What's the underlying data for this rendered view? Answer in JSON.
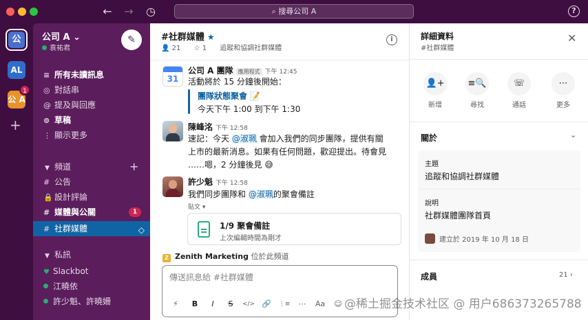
{
  "titlebar": {
    "search_placeholder": "搜尋公司 A",
    "back": "←",
    "forward": "→",
    "history": "◷",
    "help": "?"
  },
  "rail": {
    "active_workspace": "公",
    "workspace_al": "AL",
    "workspace_a": "公 A",
    "workspace_a_badge": "1",
    "add": "+"
  },
  "sidebar": {
    "workspace_name": "公司 A ⌄",
    "user": "袁祐君",
    "nav": [
      {
        "icon": "≡",
        "label": "所有未讀訊息"
      },
      {
        "icon": "◎",
        "label": "對話串"
      },
      {
        "icon": "@",
        "label": "提及與回應"
      },
      {
        "icon": "⊚",
        "label": "草稿"
      },
      {
        "icon": "⋮",
        "label": "顯示更多"
      }
    ],
    "channels_header": "頻道",
    "channels": [
      {
        "label": "公告",
        "icon": "#"
      },
      {
        "label": "設計評論",
        "icon": "🔒"
      },
      {
        "label": "媒體與公關",
        "icon": "#",
        "badge": "1"
      },
      {
        "label": "社群媒體",
        "icon": "#",
        "active_icon": "◇"
      }
    ],
    "dm_header": "私訊",
    "dms": [
      {
        "label": "Slackbot",
        "icon": "heart"
      },
      {
        "label": "江曉依",
        "icon": "dot"
      },
      {
        "label": "許少魁、許曉姍",
        "icon": "dot"
      }
    ]
  },
  "channel": {
    "title": "#社群媒體",
    "star": "★",
    "members": "21",
    "pins": "1",
    "topic": "追蹤和協調社群媒體",
    "info": "i"
  },
  "messages": [
    {
      "author": "公司 A 團隊",
      "badge": "應用程式",
      "time": "下午 12:45",
      "calendar_day": "31",
      "lines": [
        "活動將於 15 分鐘後開始："
      ],
      "event_title": "團隊狀態聚會",
      "event_emoji": "📝",
      "event_time": "今天下午 1:00 到下午 1:30"
    },
    {
      "author": "陳峰洺",
      "time": "下午 12:58",
      "line1_pre": "速記：今天 ",
      "line1_mention": "@淑珮",
      "line1_post": " 會加入我們的同步團隊，提供有關",
      "line2": "上市的最新消息。如果有任何問題，歡迎提出。待會見",
      "line3": "……嗯，2 分鐘後見 😅"
    },
    {
      "author": "許少魁",
      "time": "下午 12:58",
      "line1_pre": "我們同步團隊和 ",
      "line1_mention": "@淑珮",
      "line1_post": "的聚會備註",
      "attachment_label": "貼文 ▾",
      "file_title": "1/9 聚會備註",
      "file_sub": "上次編輯時間為剛才"
    }
  ],
  "typing": {
    "icon": "Z",
    "name": "Zenith Marketing",
    "suffix": " 位於此頻道"
  },
  "composer": {
    "placeholder": "傳送訊息給 #社群媒體",
    "tools": [
      "⚡",
      "B",
      "I",
      "S",
      "</>",
      "🔗",
      "⋮≡",
      "⋯",
      "Aa",
      "☺"
    ]
  },
  "panel": {
    "title": "詳細資料",
    "subtitle": "#社群媒體",
    "close": "✕",
    "actions": [
      {
        "icon": "👤+",
        "label": "新增"
      },
      {
        "icon": "≡🔍",
        "label": "尋找"
      },
      {
        "icon": "☏",
        "label": "通話"
      },
      {
        "icon": "⋯",
        "label": "更多"
      }
    ],
    "about_header": "關於",
    "about_chevron": "⌄",
    "topic_label": "主題",
    "topic_value": "追蹤和協調社群媒體",
    "desc_label": "說明",
    "desc_value": "社群媒體團隊首頁",
    "created": "建立於 2019 年 10 月 18 日",
    "members_header": "成員",
    "members_count": "21",
    "members_chevron": "›"
  },
  "watermark": "@稀土掘金技术社区 @ 用户686373265788",
  "colors": {
    "aubergine": "#3f0e40",
    "sidebar": "#5b1d5c",
    "active_blue": "#1164a3",
    "mention_blue": "#1264a3",
    "badge_red": "#cd2553",
    "presence_green": "#2bac76"
  }
}
